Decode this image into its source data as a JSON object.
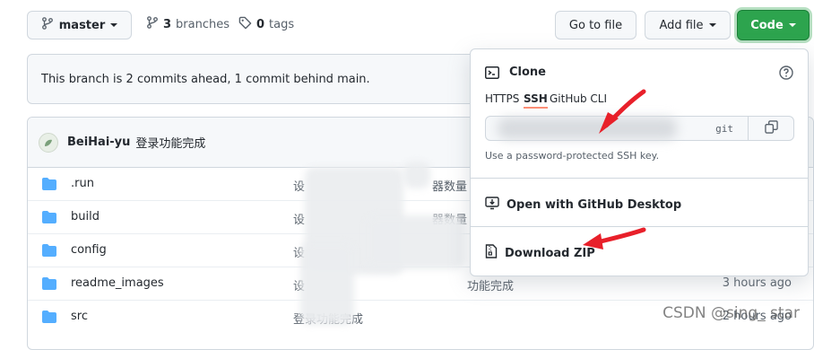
{
  "toolbar": {
    "branch_label": "master",
    "branches_count": "3",
    "branches_label": "branches",
    "tags_count": "0",
    "tags_label": "tags",
    "go_to_file_label": "Go to file",
    "add_file_label": "Add file",
    "code_label": "Code"
  },
  "banner": {
    "text": "This branch is 2 commits ahead, 1 commit behind main."
  },
  "commit": {
    "author": "BeiHai-yu",
    "message": "登录功能完成"
  },
  "files": [
    {
      "name": ".run",
      "message": "设",
      "message_tail": "器数量",
      "time": ""
    },
    {
      "name": "build",
      "message": "设",
      "message_tail": "器数量",
      "time": ""
    },
    {
      "name": "config",
      "message": "设",
      "message_tail": "",
      "time": ""
    },
    {
      "name": "readme_images",
      "message": "设",
      "message_tail": "功能完成",
      "time": "3 hours ago"
    },
    {
      "name": "src",
      "message": "登录功能完成",
      "message_tail": "",
      "time": "2 hours ago"
    }
  ],
  "dropdown": {
    "clone_title": "Clone",
    "tabs": [
      "HTTPS",
      "SSH",
      "GitHub CLI"
    ],
    "active_tab": "SSH",
    "url_suffix": "git",
    "ssh_hint": "Use a password-protected SSH key.",
    "open_desktop_label": "Open with GitHub Desktop",
    "download_zip_label": "Download ZIP"
  },
  "watermark": "CSDN @sing_ star",
  "colors": {
    "code_button": "#2da44e",
    "annotation_arrow": "#e8202a",
    "folder": "#54aeff",
    "active_tab_underline": "#fd8c73"
  }
}
